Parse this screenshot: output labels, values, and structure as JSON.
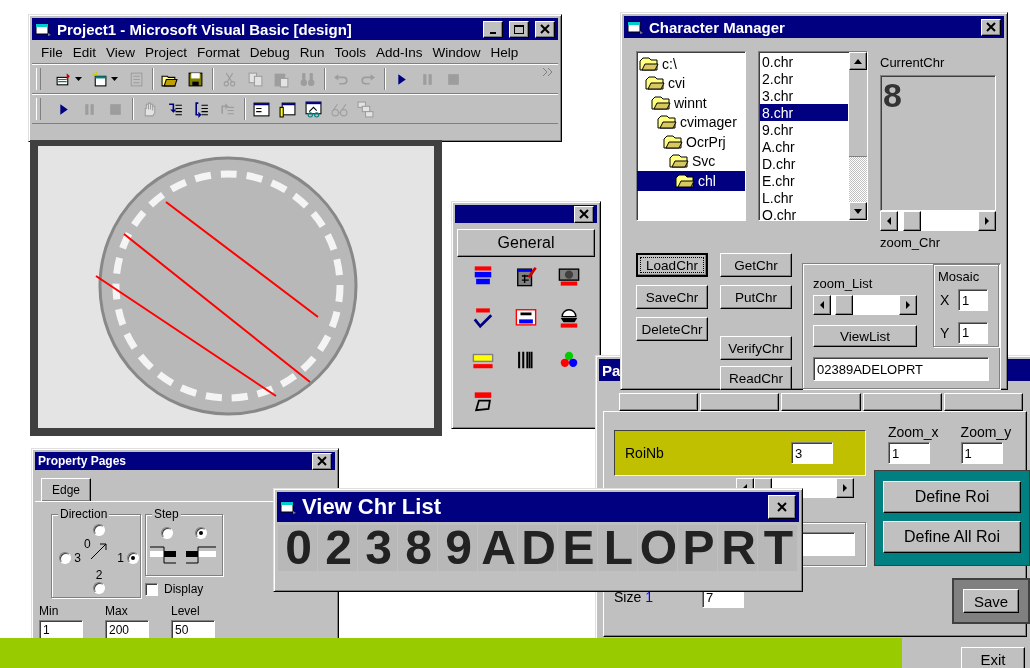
{
  "vb_window": {
    "title": "Project1 - Microsoft Visual Basic [design]",
    "window_buttons": [
      {
        "kind": "minimize"
      },
      {
        "kind": "maximize"
      },
      {
        "kind": "close"
      }
    ],
    "menu": [
      "File",
      "Edit",
      "View",
      "Project",
      "Format",
      "Debug",
      "Run",
      "Tools",
      "Add-Ins",
      "Window",
      "Help"
    ],
    "toolbars": [
      {
        "overflow": true,
        "groups": [
          [
            {
              "kind": "add-project",
              "dropdown": true,
              "disabled": false
            },
            {
              "kind": "add-form",
              "dropdown": true,
              "disabled": false
            },
            {
              "kind": "menu-editor",
              "dropdown": false,
              "disabled": true
            }
          ],
          [
            {
              "kind": "open",
              "dropdown": false,
              "disabled": false
            },
            {
              "kind": "save",
              "dropdown": false,
              "disabled": false
            }
          ],
          [
            {
              "kind": "cut",
              "dropdown": false,
              "disabled": true
            },
            {
              "kind": "copy",
              "dropdown": false,
              "disabled": true
            },
            {
              "kind": "paste",
              "dropdown": false,
              "disabled": true
            },
            {
              "kind": "find",
              "dropdown": false,
              "disabled": true
            }
          ],
          [
            {
              "kind": "undo",
              "dropdown": false,
              "disabled": true
            },
            {
              "kind": "redo",
              "dropdown": false,
              "disabled": true
            }
          ],
          [
            {
              "kind": "run",
              "dropdown": false,
              "disabled": false
            },
            {
              "kind": "pause",
              "dropdown": false,
              "disabled": true
            },
            {
              "kind": "stop",
              "dropdown": false,
              "disabled": true
            }
          ]
        ]
      },
      {
        "overflow": false,
        "groups": [
          [
            {
              "kind": "run",
              "dropdown": false,
              "disabled": false
            },
            {
              "kind": "pause",
              "dropdown": false,
              "disabled": true
            },
            {
              "kind": "stop",
              "dropdown": false,
              "disabled": true
            }
          ],
          [
            {
              "kind": "hand",
              "dropdown": false,
              "disabled": true
            },
            {
              "kind": "step-into",
              "dropdown": false,
              "disabled": false
            },
            {
              "kind": "step-over",
              "dropdown": false,
              "disabled": false
            },
            {
              "kind": "step-out",
              "dropdown": false,
              "disabled": true
            }
          ],
          [
            {
              "kind": "form-window",
              "dropdown": false,
              "disabled": false
            },
            {
              "kind": "properties",
              "dropdown": false,
              "disabled": false
            },
            {
              "kind": "object-browser",
              "dropdown": false,
              "disabled": false
            },
            {
              "kind": "quick-watch",
              "dropdown": false,
              "disabled": true
            },
            {
              "kind": "call-stack",
              "dropdown": false,
              "disabled": true
            }
          ]
        ]
      }
    ]
  },
  "toolbox": {
    "window_buttons": [
      {
        "kind": "close"
      }
    ],
    "tab": "General",
    "tools": [
      {
        "kind": "pcl"
      },
      {
        "kind": "editor"
      },
      {
        "kind": "camera"
      },
      {
        "kind": "ocr-check"
      },
      {
        "kind": "roi"
      },
      {
        "kind": "bowl"
      },
      {
        "kind": "ruler"
      },
      {
        "kind": "barcode"
      },
      {
        "kind": "color"
      },
      {
        "kind": "blob"
      }
    ]
  },
  "character_manager": {
    "title": "Character Manager",
    "window_buttons": [
      {
        "kind": "close"
      }
    ],
    "folders": [
      {
        "label": "c:\\",
        "selected": false,
        "children": [
          {
            "label": "cvi",
            "selected": false,
            "children": [
              {
                "label": "winnt",
                "selected": false,
                "children": [
                  {
                    "label": "cvimager",
                    "selected": false,
                    "children": [
                      {
                        "label": "OcrPrj",
                        "selected": false,
                        "children": [
                          {
                            "label": "Svc",
                            "selected": false,
                            "children": [
                              {
                                "label": "chl",
                                "selected": true
                              }
                            ]
                          }
                        ]
                      }
                    ]
                  }
                ]
              }
            ]
          }
        ]
      }
    ],
    "files": [
      {
        "label": "0.chr",
        "selected": false
      },
      {
        "label": "2.chr",
        "selected": false
      },
      {
        "label": "3.chr",
        "selected": false
      },
      {
        "label": "8.chr",
        "selected": true
      },
      {
        "label": "9.chr",
        "selected": false
      },
      {
        "label": "A.chr",
        "selected": false
      },
      {
        "label": "D.chr",
        "selected": false
      },
      {
        "label": "E.chr",
        "selected": false
      },
      {
        "label": "L.chr",
        "selected": false
      },
      {
        "label": "O.chr",
        "selected": false
      }
    ],
    "current_label": "CurrentChr",
    "current_char": "8",
    "zoom_chr": {
      "label": "zoom_Chr",
      "level": 0.06
    },
    "buttons_left": [
      {
        "label": "LoadChr",
        "focused": true
      },
      {
        "label": "SaveChr",
        "focused": false
      },
      {
        "label": "DeleteChr",
        "focused": false
      }
    ],
    "buttons_right": [
      {
        "label": "GetChr",
        "focused": false
      },
      {
        "label": "PutChr",
        "focused": false
      },
      {
        "label": "VerifyChr",
        "focused": false
      },
      {
        "label": "ReadChr",
        "focused": false
      }
    ],
    "zoom_list": {
      "label": "zoom_List",
      "level": 0.06
    },
    "view_button": "ViewList",
    "mosaic": {
      "label": "Mosaic",
      "fields": [
        {
          "label": "X",
          "value": "1"
        },
        {
          "label": "Y",
          "value": "1"
        }
      ]
    },
    "list_value": "02389ADELOPRT"
  },
  "parameters": {
    "title": "Pa",
    "roinb": {
      "label": "RoiNb",
      "value": "3"
    },
    "zooms": [
      {
        "label": "Zoom_x",
        "value": "1"
      },
      {
        "label": "Zoom_y",
        "value": "1"
      }
    ],
    "define_buttons": [
      "Define Roi",
      "Define All Roi"
    ],
    "save_button": "Save",
    "size": {
      "label": "Size",
      "index": "1",
      "value": "7"
    },
    "exit_button": "Exit"
  },
  "property_pages": {
    "title": "Property Pages",
    "window_buttons": [
      {
        "kind": "close"
      }
    ],
    "tab": "Edge",
    "direction": {
      "label": "Direction",
      "options": [
        {
          "kind": "top",
          "label": "0",
          "selected": false
        },
        {
          "kind": "left",
          "label": "3",
          "selected": false
        },
        {
          "kind": "right",
          "label": "1",
          "selected": true
        },
        {
          "kind": "bottom",
          "label": "2",
          "selected": false
        }
      ]
    },
    "step": {
      "label": "Step",
      "options": [
        {
          "selected": false
        },
        {
          "selected": true
        }
      ]
    },
    "display": {
      "label": "Display",
      "checked": false
    },
    "fields": [
      {
        "label": "Min",
        "value": "1"
      },
      {
        "label": "Max",
        "value": "200"
      },
      {
        "label": "Level",
        "value": "50"
      }
    ]
  },
  "view_chr_list": {
    "title": "View Chr List",
    "window_buttons": [
      {
        "kind": "close"
      }
    ],
    "chars": [
      "0",
      "2",
      "3",
      "8",
      "9",
      "A",
      "D",
      "E",
      "L",
      "O",
      "P",
      "R",
      "T"
    ]
  }
}
